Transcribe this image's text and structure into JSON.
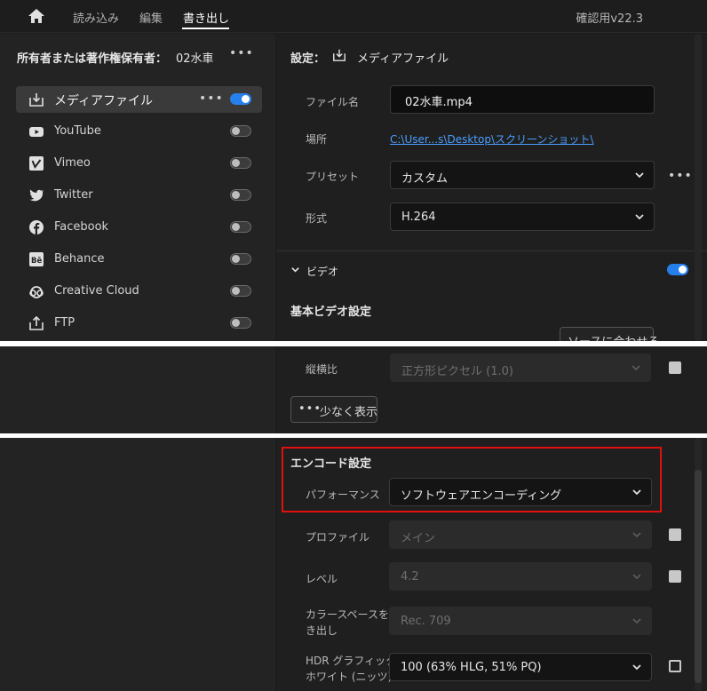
{
  "topbar": {
    "tabs": [
      "読み込み",
      "編集",
      "書き出し"
    ],
    "version": "確認用v22.3"
  },
  "left": {
    "owner_label": "所有者または著作権保有者：",
    "owner_value": "02水車",
    "destinations": [
      {
        "label": "メディアファイル",
        "icon": "download-icon",
        "on": true
      },
      {
        "label": "YouTube",
        "icon": "youtube-icon",
        "on": false
      },
      {
        "label": "Vimeo",
        "icon": "vimeo-icon",
        "on": false
      },
      {
        "label": "Twitter",
        "icon": "twitter-icon",
        "on": false
      },
      {
        "label": "Facebook",
        "icon": "facebook-icon",
        "on": false
      },
      {
        "label": "Behance",
        "icon": "behance-icon",
        "on": false
      },
      {
        "label": "Creative Cloud",
        "icon": "creative-cloud-icon",
        "on": false
      },
      {
        "label": "FTP",
        "icon": "upload-icon",
        "on": false
      }
    ]
  },
  "settings": {
    "header_label": "設定：",
    "header_value": "メディアファイル",
    "filename_label": "ファイル名",
    "filename_value": "02水車.mp4",
    "location_label": "場所",
    "location_value": "C:\\User...s\\Desktop\\スクリーンショット\\",
    "preset_label": "プリセット",
    "preset_value": "カスタム",
    "format_label": "形式",
    "format_value": "H.264",
    "video_section": "ビデオ",
    "basic_video": "基本ビデオ設定",
    "match_source_button": "ソースに合わせる",
    "aspect_label": "縦横比",
    "aspect_value": "正方形ピクセル (1.0)",
    "show_less": "少なく表示",
    "encode_section": "エンコード設定",
    "performance_label": "パフォーマンス",
    "performance_value": "ソフトウェアエンコーディング",
    "profile_label": "プロファイル",
    "profile_value": "メイン",
    "level_label": "レベル",
    "level_value": "4.2",
    "colorspace_label_1": "カラースペースを書",
    "colorspace_label_2": "き出し",
    "colorspace_value": "Rec. 709",
    "hdr_label_1": "HDR グラフィック",
    "hdr_label_2": "ホワイト (ニッツ)",
    "hdr_value": "100 (63% HLG, 51% PQ)"
  },
  "colors": {
    "accent": "#2680eb",
    "highlight": "#e01010",
    "link": "#4a9eff"
  }
}
